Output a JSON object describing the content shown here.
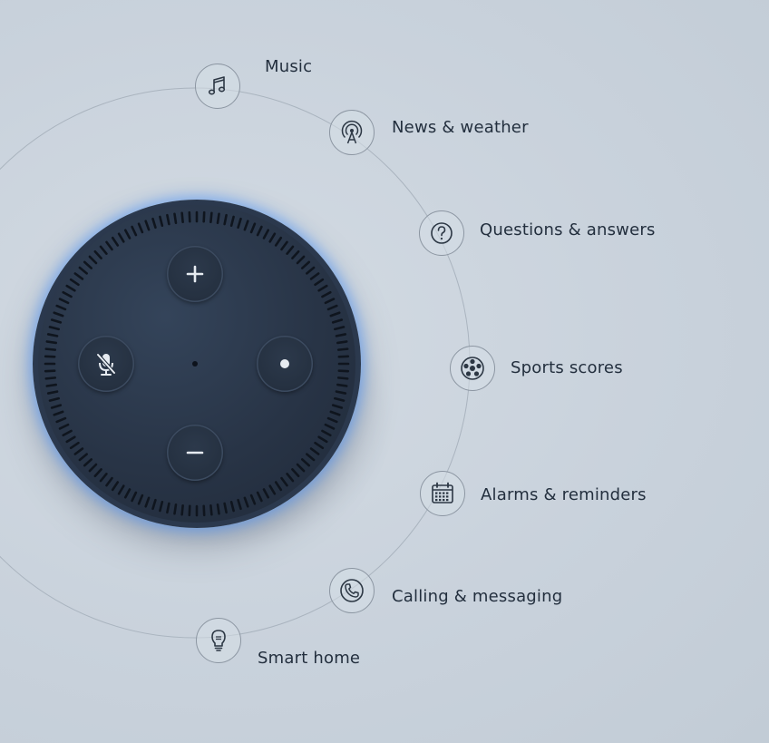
{
  "features": [
    {
      "label": "Music",
      "icon": "music-note-icon"
    },
    {
      "label": "News & weather",
      "icon": "broadcast-tower-icon"
    },
    {
      "label": "Questions & answers",
      "icon": "question-icon"
    },
    {
      "label": "Sports scores",
      "icon": "soccer-ball-icon"
    },
    {
      "label": "Alarms & reminders",
      "icon": "calendar-icon"
    },
    {
      "label": "Calling & messaging",
      "icon": "phone-icon"
    },
    {
      "label": "Smart home",
      "icon": "light-bulb-icon"
    }
  ],
  "device": {
    "buttons": [
      "volume-up",
      "mute-microphone",
      "action",
      "volume-down"
    ],
    "light_ring_color": "#4fa3ff"
  },
  "colors": {
    "text": "#232f3e",
    "icon_stroke": "#2c3744"
  }
}
